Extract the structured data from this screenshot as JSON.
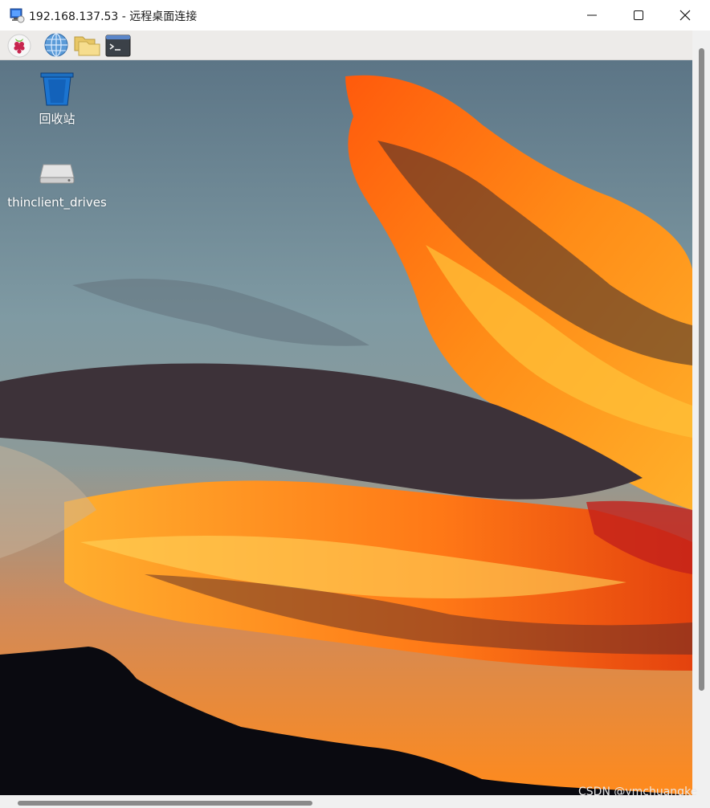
{
  "window": {
    "title": "192.168.137.53 - 远程桌面连接",
    "icon": "remote-desktop-icon",
    "controls": [
      "minimize-icon",
      "maximize-icon",
      "close-icon"
    ]
  },
  "taskbar": {
    "launchers": [
      "raspberry-pi-menu-icon",
      "web-browser-icon",
      "file-manager-icon",
      "terminal-icon"
    ]
  },
  "desktop": {
    "icons": [
      {
        "label": "回收站",
        "icon": "trash-icon"
      },
      {
        "label": "thinclient_drives",
        "icon": "drive-icon"
      }
    ],
    "wallpaper": "sunset-clouds"
  },
  "watermark": "CSDN @ymchuangke",
  "colors": {
    "taskbar_bg": "#edebe9",
    "titlebar_bg": "#ffffff",
    "sky": "#6c8898",
    "cloud_orange": "#ff7a12"
  }
}
